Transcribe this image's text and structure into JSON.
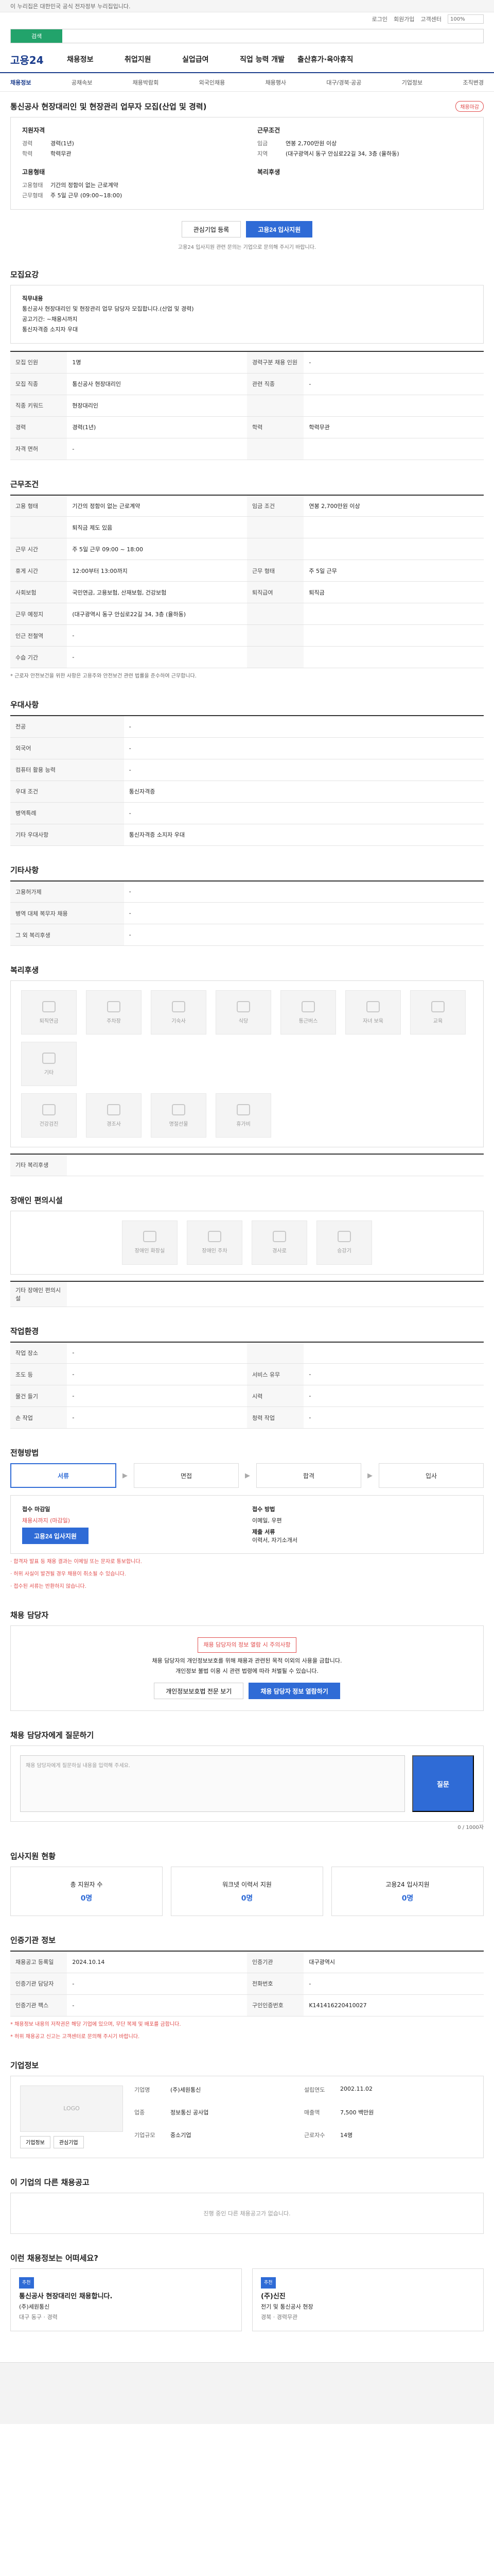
{
  "topbar": {
    "text": "이 누리집은 대한민국 공식 전자정부 누리집입니다."
  },
  "util": {
    "links": [
      "로그인",
      "회원가입",
      "고객센터"
    ],
    "zoom": "100%"
  },
  "search": {
    "placeholder": "검색"
  },
  "gnb": {
    "logo": "고용24",
    "menus": [
      "채용정보",
      "취업지원",
      "실업급여",
      "직업 능력 개발",
      "출산휴가·육아휴직"
    ]
  },
  "sub": {
    "items": [
      "채용정보",
      "공채속보",
      "채용박람회",
      "외국인채용",
      "채용행사",
      "대구/경북·공공",
      "기업정보",
      "조직변경"
    ],
    "active": 0
  },
  "job": {
    "title": "통신공사 현장대리인 및 현장관리 업무자 모집(산업 및 경력)",
    "badge": "채용마감",
    "left_h": "지원자격",
    "right_h": "근무조건",
    "left": [
      {
        "k": "경력",
        "v": "경력(1년)"
      },
      {
        "k": "학력",
        "v": "학력무관"
      }
    ],
    "right": [
      {
        "k": "임금",
        "v": "연봉 2,700만원 이상"
      },
      {
        "k": "지역",
        "v": "(대구광역시 동구 안심로22길 34, 3층 (율하동)"
      }
    ],
    "left2_h": "고용형태",
    "right2_h": "복리후생",
    "left2": [
      {
        "k": "고용형태",
        "v": "기간의 정함이 없는 근로계약"
      },
      {
        "k": "근무형태",
        "v": "주 5일 근무 (09:00~18:00)"
      }
    ],
    "right2": []
  },
  "buttons": {
    "interest": "관심기업 등록",
    "apply": "고용24 입사지원"
  },
  "note1": "고용24 입사지원 관련 문의는 기업으로 문의해 주시기 바랍니다.",
  "sections": {
    "recruit": "모집요강",
    "work": "근무조건",
    "pref": "우대사항",
    "other": "기타사항",
    "welfare": "복리후생",
    "disabled": "장애인 편의시설",
    "workenv": "작업환경",
    "process": "전형방법",
    "contact": "채용 담당자",
    "qa": "채용 담당자에게 질문하기",
    "status": "입사지원 현황",
    "agency": "인증기관 정보",
    "company": "기업정보",
    "others": "이 기업의 다른 채용공고",
    "recs": "이런 채용정보는 어떠세요?"
  },
  "recruit": {
    "job_h": "직무내용",
    "job": "통신공사 현장대리인 및 현장관리 업무 담당자 모집합니다.(산업 및 경력)",
    "extra": "공고기간: ~채용시까지",
    "extra2": "통신자격증 소지자 우대"
  },
  "recruit_tbl": [
    [
      "모집 인원",
      "1명",
      "경력구분 채용 인원",
      "-"
    ],
    [
      "모집 직종",
      "통신공사 현장대리인",
      "관련 직종",
      "-"
    ],
    [
      "직종 키워드",
      "현장대리인",
      "",
      ""
    ],
    [
      "경력",
      "경력(1년)",
      "학력",
      "학력무관"
    ],
    [
      "자격 면허",
      "-",
      "",
      ""
    ]
  ],
  "work_tbl": [
    [
      "고용 형태",
      "기간의 정함이 없는 근로계약",
      "임금 조건",
      "연봉 2,700만원 이상"
    ],
    [
      "",
      "퇴직금 제도 있음",
      "",
      ""
    ],
    [
      "근무 시간",
      "주 5일 근무 09:00 ~ 18:00",
      "",
      ""
    ],
    [
      "휴게 시간",
      "12:00부터 13:00까지",
      "근무 형태",
      "주 5일 근무"
    ],
    [
      "사회보험",
      "국민연금, 고용보험, 산재보험, 건강보험",
      "퇴직급여",
      "퇴직금"
    ],
    [
      "근무 예정지",
      "(대구광역시 동구 안심로22길 34, 3층 (율하동)",
      "",
      ""
    ],
    [
      "인근 전철역",
      "-",
      "",
      ""
    ],
    [
      "수습 기간",
      "-",
      "",
      ""
    ]
  ],
  "work_note": "* 근로자 안전보건을 위한 사항은 고용주와 안전보건 관련 법률을 준수하여 근무합니다.",
  "pref_tbl": [
    [
      "전공",
      "-"
    ],
    [
      "외국어",
      "-"
    ],
    [
      "컴퓨터 활용 능력",
      "-"
    ],
    [
      "우대 조건",
      "통신자격증"
    ],
    [
      "병역특례",
      "-"
    ],
    [
      "기타 우대사항",
      "통신자격증 소지자 우대"
    ]
  ],
  "other_tbl": [
    [
      "고용허가제",
      "-"
    ],
    [
      "병역 대체 복무자 채용",
      "-"
    ],
    [
      "그 외 복리후생",
      "-"
    ]
  ],
  "welfare_icons": [
    "퇴직연금",
    "주차장",
    "기숙사",
    "식당",
    "통근버스",
    "자녀 보육",
    "교육",
    "기타"
  ],
  "welfare_icons2": [
    "건강검진",
    "경조사",
    "명절선물",
    "휴가비"
  ],
  "welfare_note": "기타 복리후생",
  "disabled_icons": [
    "장애인 화장실",
    "장애인 주차",
    "경사로",
    "승강기"
  ],
  "disabled_note": "기타 장애인 편의시설",
  "env_tbl": [
    [
      "작업 장소",
      "-",
      "",
      ""
    ],
    [
      "조도 등",
      "-",
      "서비스 유무",
      "-"
    ],
    [
      "물건 들기",
      "-",
      "시력",
      "-"
    ],
    [
      "손 작업",
      "-",
      "청력 작업",
      "-"
    ]
  ],
  "process": {
    "steps": [
      "서류",
      "면접",
      "합격",
      "입사"
    ],
    "active": 0
  },
  "apply": {
    "method_h": "접수 마감일",
    "deadline": "채용시까지 (마감일)",
    "apply_btn": "고용24 입사지원",
    "method2_h": "접수 방법",
    "method2": "이메일, 우편",
    "docs_h": "제출 서류",
    "docs": "이력서, 자기소개서"
  },
  "apply_notes": [
    "· 합격자 발표 등 채용 결과는 이메일 또는 문자로 통보합니다.",
    "· 허위 사실이 발견될 경우 채용이 취소될 수 있습니다.",
    "· 접수된 서류는 반환하지 않습니다."
  ],
  "contact": {
    "warn": "채용 담당자의 정보 열람 시 주의사항",
    "text": "채용 담당자의 개인정보보호를 위해 채용과 관련된 목적 이외의 사용을 금합니다.",
    "text2": "개인정보 불법 이용 시 관련 법령에 따라 처벌될 수 있습니다.",
    "btn1": "개인정보보호법 전문 보기",
    "btn2": "채용 담당자 정보 열람하기"
  },
  "qa": {
    "placeholder": "채용 담당자에게 질문하실 내용을 입력해 주세요.",
    "count": "0 / 1000자",
    "btn": "질문"
  },
  "status": [
    {
      "label": "총 지원자 수",
      "n": "0명"
    },
    {
      "label": "워크넷 이력서 지원",
      "n": "0명"
    },
    {
      "label": "고용24 입사지원",
      "n": "0명"
    }
  ],
  "agency_tbl": [
    [
      "채용공고 등록일",
      "2024.10.14",
      "인증기관",
      "대구광역시"
    ],
    [
      "인증기관 담당자",
      "-",
      "전화번호",
      "-"
    ],
    [
      "인증기관 팩스",
      "-",
      "구인인증번호",
      "K141416220410027"
    ]
  ],
  "agency_notes": [
    "* 채용정보 내용의 저작권은 해당 기업에 있으며, 무단 복제 및 배포를 금합니다.",
    "* 허위 채용공고 신고는 고객센터로 문의해 주시기 바랍니다."
  ],
  "company": {
    "logo": "LOGO",
    "rows": [
      [
        "기업명",
        "(주)세원통신",
        "설립연도",
        "2002.11.02"
      ],
      [
        "업종",
        "정보통신 공사업",
        "매출액",
        "7,500 백만원"
      ],
      [
        "기업규모",
        "중소기업",
        "근로자수",
        "14명"
      ]
    ],
    "btn1": "기업정보",
    "btn2": "관심기업"
  },
  "others_empty": "진행 중인 다른 채용공고가 없습니다.",
  "recs": [
    {
      "tag": "추천",
      "t": "통신공사 현장대리인 채용합니다.",
      "s": "(주)세원통신",
      "d": "대구 동구 · 경력"
    },
    {
      "tag": "추천",
      "t": "(주)신진",
      "s": "전기 및 통신공사 현장",
      "d": "경북 · 경력무관"
    }
  ]
}
